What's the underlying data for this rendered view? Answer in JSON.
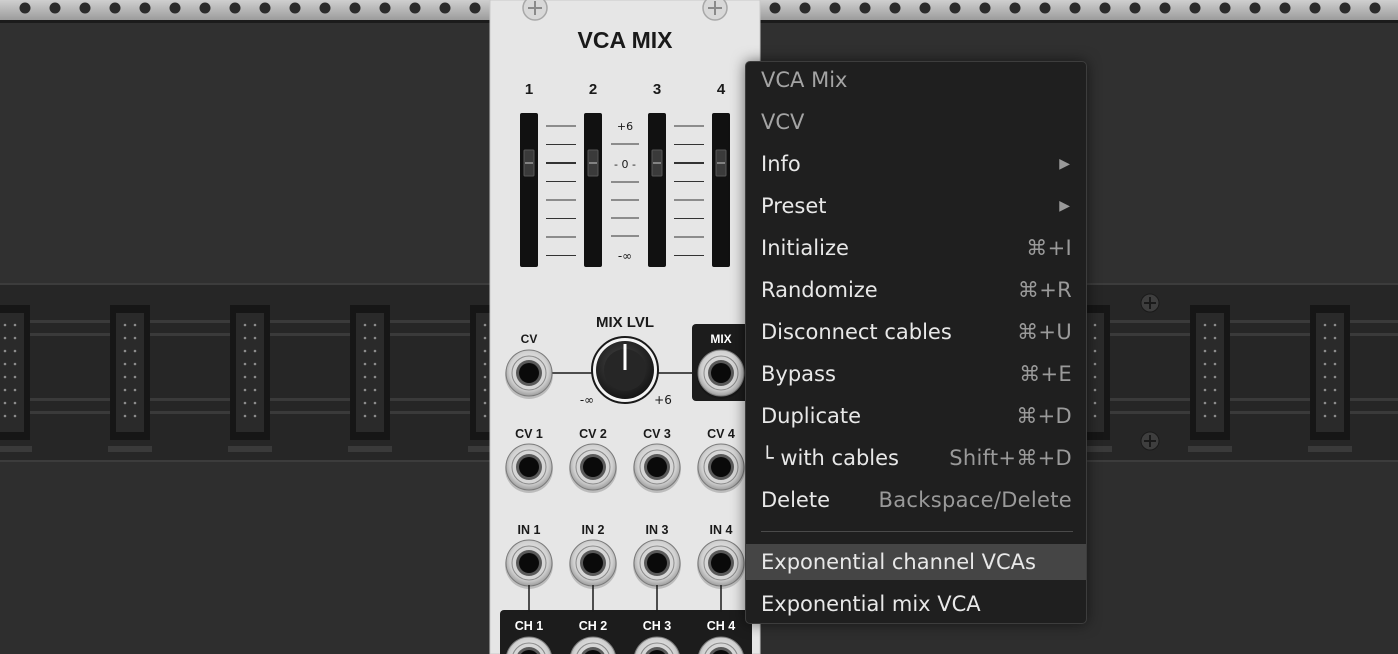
{
  "module": {
    "title": "VCA MIX",
    "channel_numbers": [
      "1",
      "2",
      "3",
      "4"
    ],
    "scale": {
      "plus6": "+6",
      "zero": "- 0 -",
      "neg_inf": "-∞"
    },
    "cv_label": "CV",
    "mix_lvl_label": "MIX LVL",
    "mix_label": "MIX",
    "knob_min": "-∞",
    "knob_max": "+6",
    "cv_inputs": [
      "CV 1",
      "CV 2",
      "CV 3",
      "CV 4"
    ],
    "in_inputs": [
      "IN 1",
      "IN 2",
      "IN 3",
      "IN 4"
    ],
    "ch_outputs": [
      "CH 1",
      "CH 2",
      "CH 3",
      "CH 4"
    ]
  },
  "context_menu": {
    "items": [
      {
        "label": "VCA Mix",
        "shortcut": "",
        "type": "header"
      },
      {
        "label": "VCV",
        "shortcut": "",
        "type": "header"
      },
      {
        "label": "Info",
        "shortcut": "▶",
        "type": "submenu"
      },
      {
        "label": "Preset",
        "shortcut": "▶",
        "type": "submenu"
      },
      {
        "label": "Initialize",
        "shortcut": "⌘+I",
        "type": "item"
      },
      {
        "label": "Randomize",
        "shortcut": "⌘+R",
        "type": "item"
      },
      {
        "label": "Disconnect cables",
        "shortcut": "⌘+U",
        "type": "item"
      },
      {
        "label": "Bypass",
        "shortcut": "⌘+E",
        "type": "item"
      },
      {
        "label": "Duplicate",
        "shortcut": "⌘+D",
        "type": "item"
      },
      {
        "label": "└ with cables",
        "shortcut": "Shift+⌘+D",
        "type": "item"
      },
      {
        "label": "Delete",
        "shortcut": "Backspace/Delete",
        "type": "item"
      },
      {
        "label": "Exponential channel VCAs",
        "shortcut": "",
        "type": "item",
        "highlighted": true
      },
      {
        "label": "Exponential mix VCA",
        "shortcut": "",
        "type": "item"
      }
    ]
  },
  "colors": {
    "background": "#2a2a2a",
    "panel": "#e6e6e6",
    "menu_bg": "#1f1f1f",
    "menu_highlight": "#454545"
  }
}
